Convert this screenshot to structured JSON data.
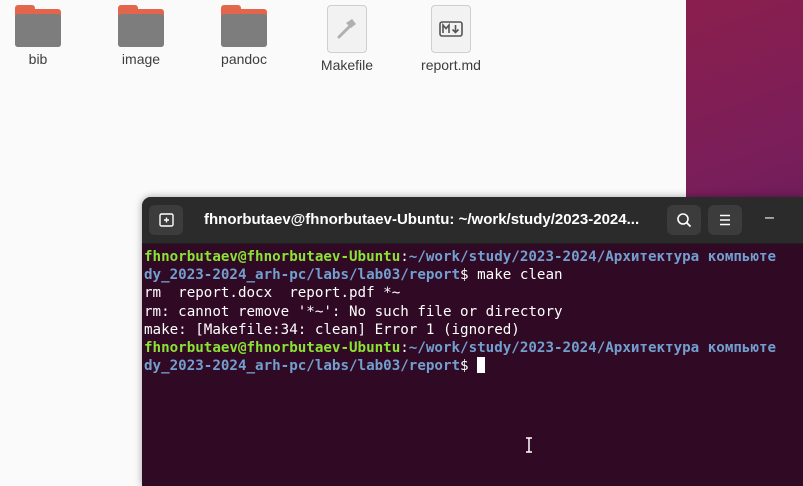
{
  "files": [
    {
      "name": "bib",
      "icon": "folder-icon"
    },
    {
      "name": "image",
      "icon": "folder-icon"
    },
    {
      "name": "pandoc",
      "icon": "folder-icon"
    },
    {
      "name": "Makefile",
      "icon": "makefile-icon"
    },
    {
      "name": "report.md",
      "icon": "markdown-file-icon"
    }
  ],
  "terminal": {
    "title": "fhnorbutaev@fhnorbutaev-Ubuntu: ~/work/study/2023-2024...",
    "lines": [
      {
        "user": "fhnorbutaev@fhnorbutaev-Ubuntu",
        "colon": ":",
        "path": "~/work/study/2023-2024/Архитектура компьюте"
      },
      {
        "path": "dy_2023-2024_arh-pc/labs/lab03/report",
        "prompt": "$ ",
        "command": "make clean"
      },
      {
        "text": "rm  report.docx  report.pdf *~"
      },
      {
        "text": "rm: cannot remove '*~': No such file or directory"
      },
      {
        "text": "make: [Makefile:34: clean] Error 1 (ignored)"
      },
      {
        "user": "fhnorbutaev@fhnorbutaev-Ubuntu",
        "colon": ":",
        "path": "~/work/study/2023-2024/Архитектура компьюте"
      },
      {
        "path": "dy_2023-2024_arh-pc/labs/lab03/report",
        "prompt": "$ "
      }
    ],
    "minimize_glyph": "–"
  },
  "colors": {
    "terminal_bg": "#300a24",
    "user_green": "#8ae234",
    "path_blue": "#729fcf",
    "folder_orange": "#e4654b"
  }
}
